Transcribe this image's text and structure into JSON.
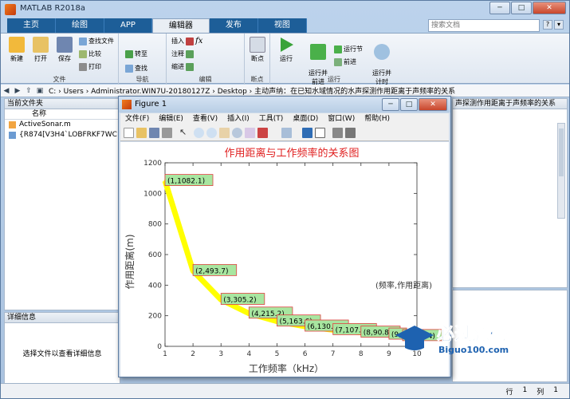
{
  "window": {
    "title": "MATLAB R2018a",
    "minimize": "─",
    "maximize": "□",
    "close": "✕"
  },
  "tabs": [
    "主页",
    "绘图",
    "APP",
    "编辑器",
    "发布",
    "视图"
  ],
  "search": {
    "placeholder": "搜索文档"
  },
  "ribbon": {
    "file_group": {
      "label": "文件",
      "new": "新建",
      "open": "打开",
      "save": "保存",
      "find_files": "查找文件",
      "compare": "比较",
      "print": "打印"
    },
    "nav_group": {
      "label": "导航",
      "goto": "转至",
      "find": "查找"
    },
    "edit_group": {
      "label": "编辑",
      "insert": "插入",
      "comment": "注释",
      "indent": "缩进"
    },
    "breakpoints_group": {
      "label": "断点",
      "breakpoints": "断点"
    },
    "run_group": {
      "label": "运行",
      "run": "运行",
      "run_advance": "运行并\n前进",
      "run_section": "运行节",
      "advance": "前进",
      "run_time": "运行并\n计时"
    }
  },
  "address": {
    "path": "C: › Users › Administrator.WIN7U-20180127Z › Desktop › 主动声纳：在已知水域情况的水声探测作用距离于声频率的关系"
  },
  "current_folder": {
    "title": "当前文件夹",
    "column": "名称",
    "files": [
      "ActiveSonar.m",
      "{R874[V3H4`LOBFRKF7WC"
    ]
  },
  "details": {
    "title": "详细信息",
    "message": "选择文件以查看详细信息"
  },
  "right_panel": {
    "title": "声探测作用距离于声频率的关系"
  },
  "status": {
    "row_label": "行",
    "row": "1",
    "col_label": "列",
    "col": "1"
  },
  "figure": {
    "title": "Figure 1",
    "menu": [
      "文件(F)",
      "编辑(E)",
      "查看(V)",
      "插入(I)",
      "工具(T)",
      "桌面(D)",
      "窗口(W)",
      "帮助(H)"
    ]
  },
  "chart_data": {
    "type": "line",
    "title": "作用距离与工作频率的关系图",
    "xlabel": "工作频率（kHz）",
    "ylabel": "作用距离(m)",
    "xlim": [
      1,
      10
    ],
    "ylim": [
      0,
      1200
    ],
    "xticks": [
      1,
      2,
      3,
      4,
      5,
      6,
      7,
      8,
      9,
      10
    ],
    "yticks": [
      0,
      200,
      400,
      600,
      800,
      1000,
      1200
    ],
    "x": [
      1,
      2,
      3,
      4,
      5,
      6,
      7,
      8,
      9,
      10
    ],
    "y": [
      1082.1,
      493.7,
      305.2,
      215.2,
      163.6,
      130.4,
      107.5,
      90.8,
      78.0,
      68.4
    ],
    "point_labels": [
      "(1,1082.1)",
      "(2,493.7)",
      "(3,305.2)",
      "(4,215.2)",
      "(5,163.6)",
      "(6,130.4)",
      "(7,107.5)",
      "(8,90.8)",
      "(9,",
      "10,68.4)"
    ],
    "annotation": "(频率,作用距离)",
    "line_color": "#ffff00",
    "label_bg": "#a8e6a0",
    "label_border": "#e04040",
    "title_color": "#e02020"
  },
  "watermark": {
    "text": "必过源码",
    "url": "Biguo100.com"
  }
}
